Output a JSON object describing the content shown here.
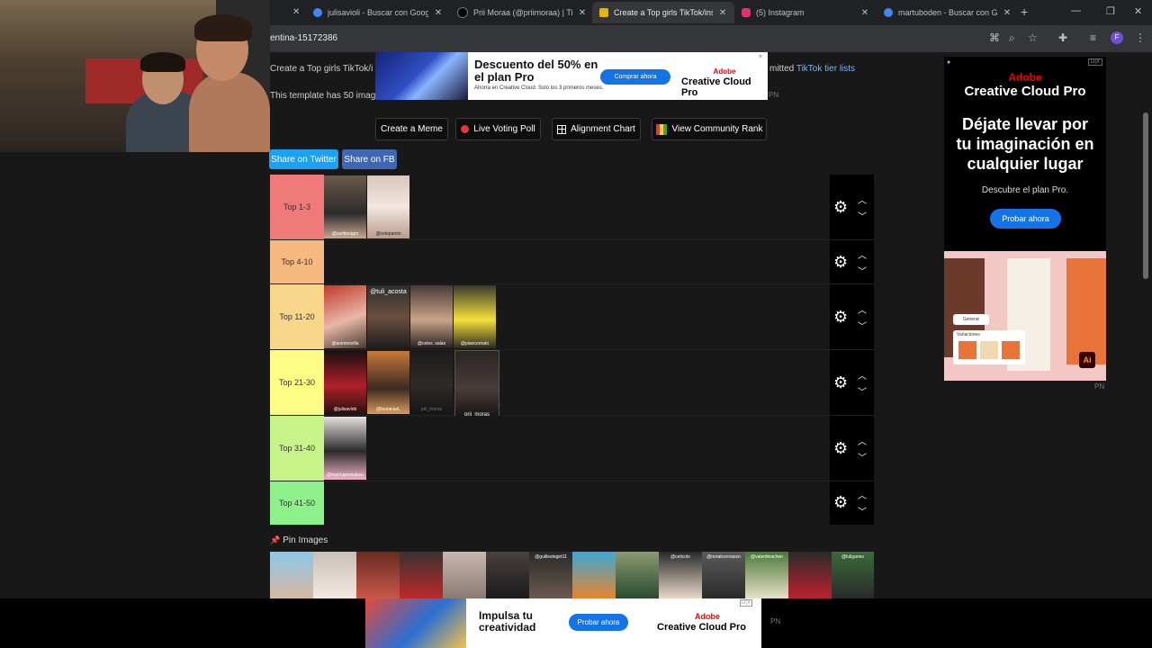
{
  "browser": {
    "tabs": [
      {
        "title": "julisavioli - Buscar con Google",
        "favicon_color": "#4285f4"
      },
      {
        "title": "Prii Moraa (@priimoraa) | TikTok",
        "favicon_color": "#000000"
      },
      {
        "title": "Create a Top girls TikTok/insta",
        "favicon_color": "#e6b400"
      },
      {
        "title": "(5) Instagram",
        "favicon_color": "#e1306c"
      },
      {
        "title": "martuboden - Buscar con Google",
        "favicon_color": "#4285f4"
      }
    ],
    "new_tab": "+",
    "url_fragment": "entina-15172386",
    "profile_letter": "F"
  },
  "page": {
    "intro_left": "Create a Top girls TikTok/i",
    "intro_right": "mitted",
    "tiktok_link": "TikTok tier lists",
    "template_info": "This template has 50 imag",
    "pn_label": "PN",
    "buttons": {
      "create_meme": "Create a Meme",
      "live_voting": "Live Voting Poll",
      "alignment_chart": "Alignment Chart",
      "community_rank": "View Community Rank"
    },
    "share_twitter": "Share on Twitter",
    "share_fb": "Share on FB",
    "pin_images": "Pin Images"
  },
  "ads": {
    "top": {
      "headline": "Descuento del 50% en el plan Pro",
      "sub": "Ahorra en Creative Cloud. Solo los 3 primeros meses.",
      "button": "Comprar ahora",
      "brand_top": "Adobe",
      "brand": "Creative Cloud Pro"
    },
    "right": {
      "brand_top": "Adobe",
      "brand": "Creative Cloud Pro",
      "headline": "Déjate llevar por tu imaginación en cualquier lugar",
      "sub": "Descubre el plan Pro.",
      "button": "Probar ahora",
      "generate": "Generar",
      "variations": "Variaciones",
      "ai": "Ai"
    },
    "bottom": {
      "headline": "Impulsa tu creatividad",
      "button": "Probar ahora",
      "brand_top": "Adobe",
      "brand": "Creative Cloud Pro",
      "pn": "PN"
    },
    "adchoice": "D|X"
  },
  "tiers": [
    {
      "label": "Top 1-3",
      "color": "#f0797a",
      "items": [
        "@carlitonigro",
        "@celepamio"
      ]
    },
    {
      "label": "Top 4-10",
      "color": "#f6b97f",
      "items": []
    },
    {
      "label": "Top 11-20",
      "color": "#f8d68a",
      "items": [
        "@aninmovilla",
        "@tuli_acosta",
        "@celes. salas",
        "@piaocornato"
      ]
    },
    {
      "label": "Top 21-30",
      "color": "#fdfc85",
      "items": [
        "@julisaviob",
        "@lauracazL",
        "prii_moras",
        "prii_moras"
      ]
    },
    {
      "label": "Top 31-40",
      "color": "#c6f489",
      "items": [
        "@martuamoraleso"
      ]
    },
    {
      "label": "Top 41-50",
      "color": "#8ef08a",
      "items": []
    }
  ],
  "pin_strip": [
    "",
    "",
    "",
    "",
    "",
    "",
    "@guillesteget11",
    "",
    "",
    "@celicolo",
    "@renatozevaszo",
    "@valentinachen",
    "",
    "@luliganes"
  ]
}
